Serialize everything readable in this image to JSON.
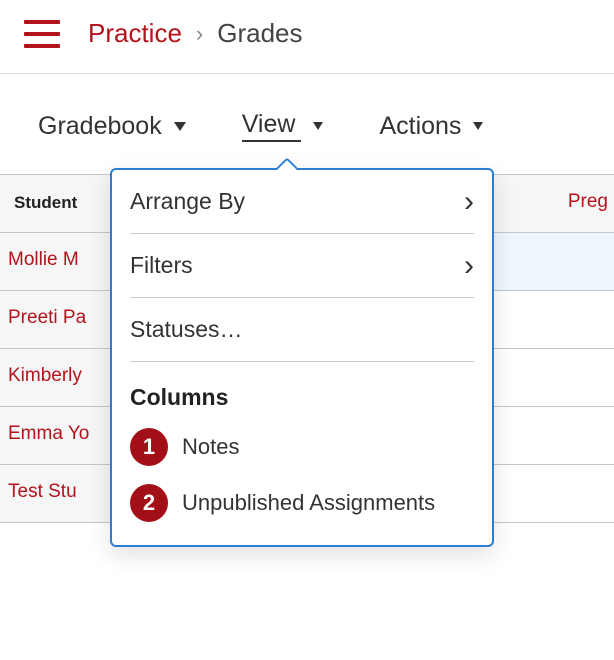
{
  "breadcrumb": {
    "course": "Practice",
    "page": "Grades"
  },
  "toolbar": {
    "gradebook_label": "Gradebook",
    "view_label": "View",
    "actions_label": "Actions"
  },
  "grid": {
    "student_header": "Student",
    "assignment_label_partial": "Preg",
    "rows": [
      {
        "name": "Mollie M"
      },
      {
        "name": "Preeti Pa"
      },
      {
        "name": "Kimberly"
      },
      {
        "name": "Emma Yo"
      },
      {
        "name": "Test Stu"
      }
    ]
  },
  "view_menu": {
    "arrange_by": "Arrange By",
    "filters": "Filters",
    "statuses": "Statuses…",
    "columns_heading": "Columns",
    "items": [
      {
        "num": "1",
        "label": "Notes"
      },
      {
        "num": "2",
        "label": "Unpublished Assignments"
      }
    ]
  }
}
